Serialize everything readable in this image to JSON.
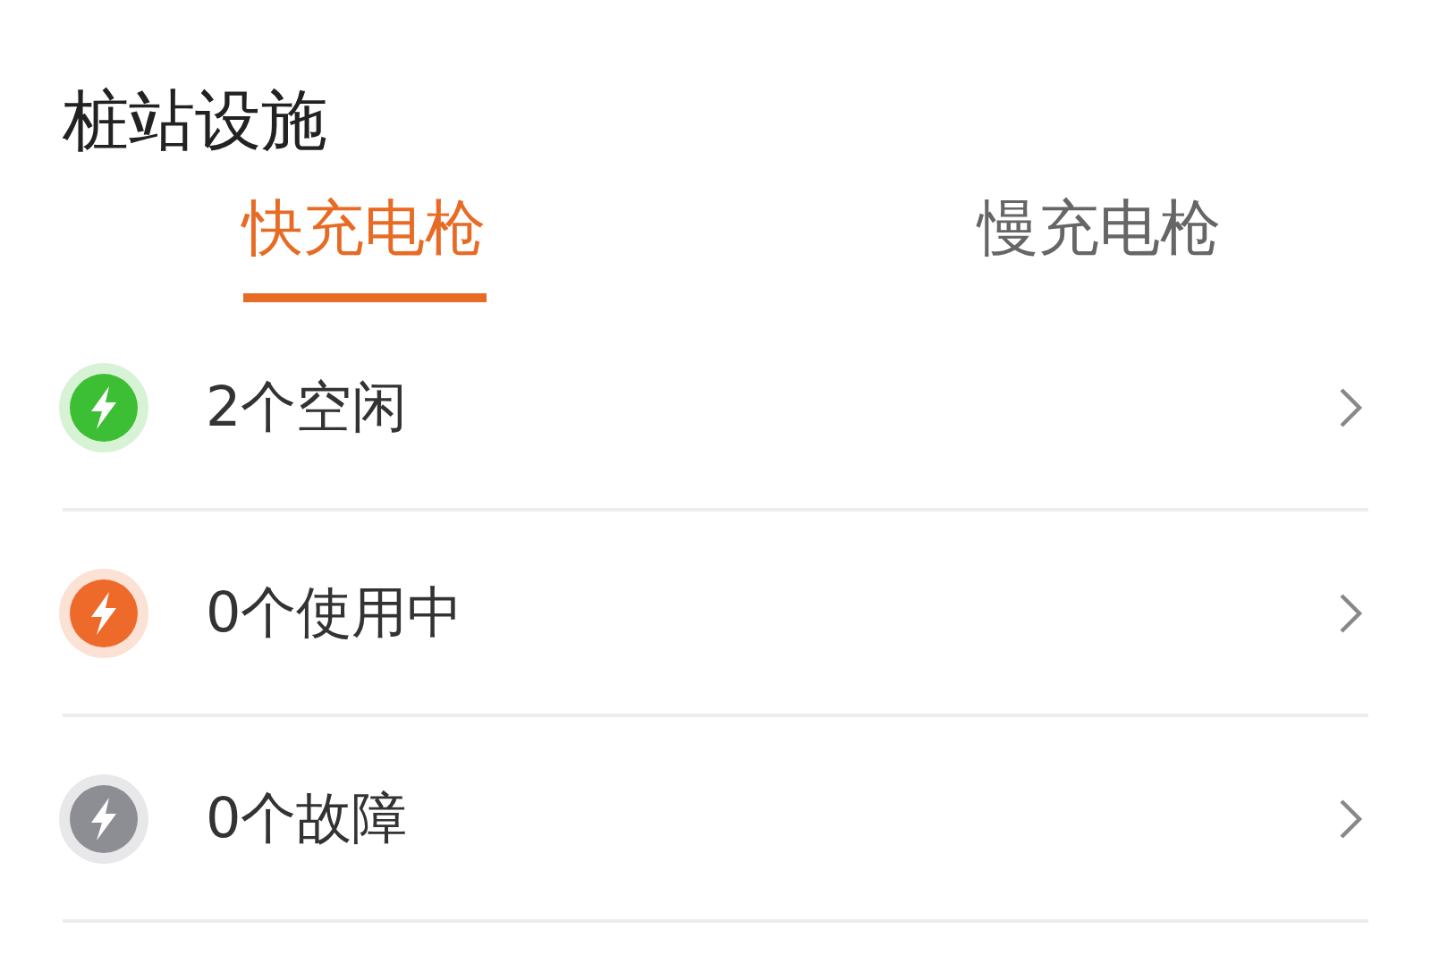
{
  "title": "桩站设施",
  "tabs": [
    {
      "label": "快充电枪",
      "selected": true
    },
    {
      "label": "慢充电枪",
      "selected": false
    }
  ],
  "statuses": [
    {
      "label": "2个空闲",
      "color": "#3cbf34"
    },
    {
      "label": "0个使用中",
      "color": "#ee6a2b"
    },
    {
      "label": "0个故障",
      "color": "#8d8d94"
    }
  ]
}
